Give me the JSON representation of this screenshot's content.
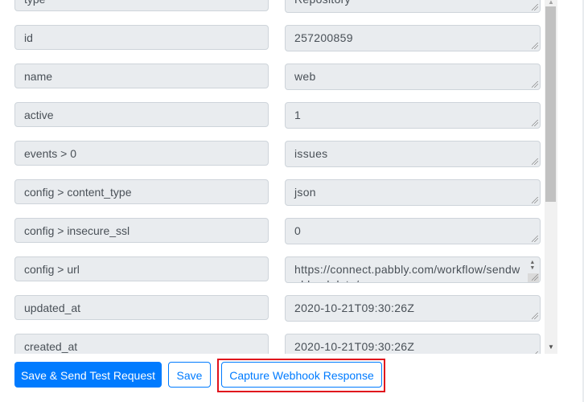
{
  "fields": [
    {
      "key": "type",
      "value": "Repository"
    },
    {
      "key": "id",
      "value": "257200859"
    },
    {
      "key": "name",
      "value": "web"
    },
    {
      "key": "active",
      "value": "1"
    },
    {
      "key": "events > 0",
      "value": "issues"
    },
    {
      "key": "config > content_type",
      "value": "json"
    },
    {
      "key": "config > insecure_ssl",
      "value": "0"
    },
    {
      "key": "config > url",
      "value": "https://connect.pabbly.com/workflow/sendwebhookdata/..."
    },
    {
      "key": "updated_at",
      "value": "2020-10-21T09:30:26Z"
    },
    {
      "key": "created_at",
      "value": "2020-10-21T09:30:26Z"
    }
  ],
  "scrollbar": {
    "up_icon": "▲",
    "down_icon": "▼",
    "scroll_position_fraction": 0.0
  },
  "buttons": {
    "save_send_test": "Save & Send Test Request",
    "save": "Save",
    "capture_webhook": "Capture Webhook Response"
  },
  "colors": {
    "primary": "#007bff",
    "field_bg": "#e9ecef",
    "highlight": "#e0121c"
  }
}
